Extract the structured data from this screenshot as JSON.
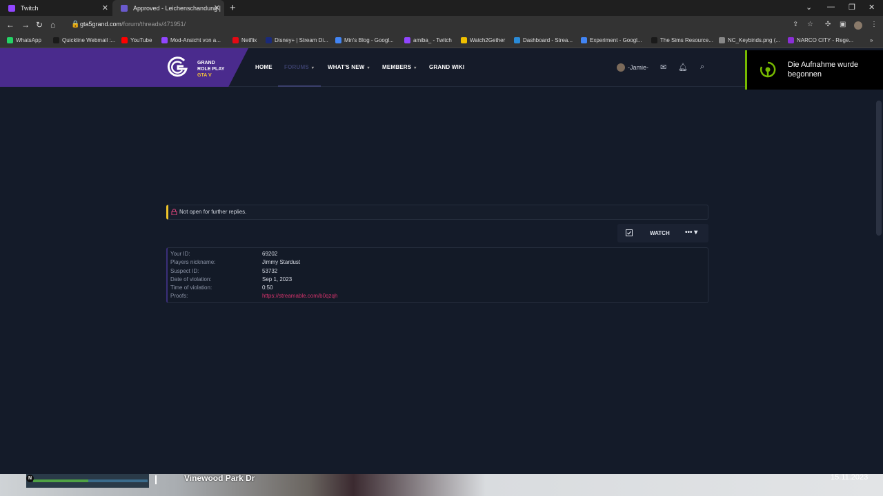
{
  "browser": {
    "tabs": [
      {
        "label": "Twitch"
      },
      {
        "label": "Approved - Leichenschandung |"
      }
    ],
    "url_host": "gta5grand.com",
    "url_path": "/forum/threads/471951/",
    "bookmarks": [
      {
        "label": "WhatsApp",
        "color": "#25d366"
      },
      {
        "label": "Quickline Webmail :...",
        "color": "#1a1a1a"
      },
      {
        "label": "YouTube",
        "color": "#ff0000"
      },
      {
        "label": "Mod-Ansicht von a...",
        "color": "#9146ff"
      },
      {
        "label": "Netflix",
        "color": "#e50914"
      },
      {
        "label": "Disney+ | Stream Di...",
        "color": "#1a2a7a"
      },
      {
        "label": "Min's Blog - Googl...",
        "color": "#4285f4"
      },
      {
        "label": "amiba_ - Twitch",
        "color": "#9146ff"
      },
      {
        "label": "Watch2Gether",
        "color": "#f0c000"
      },
      {
        "label": "Dashboard - Strea...",
        "color": "#2a8bd8"
      },
      {
        "label": "Experiment - Googl...",
        "color": "#4285f4"
      },
      {
        "label": "The Sims Resource...",
        "color": "#1a1a1a"
      },
      {
        "label": "NC_Keybinds.png (...",
        "color": "#888888"
      },
      {
        "label": "NARCO CITY - Rege...",
        "color": "#8b2fd6"
      }
    ]
  },
  "site": {
    "logo_line1": "GRAND",
    "logo_line2": "ROLE PLAY",
    "logo_line3": "GTA V",
    "nav": {
      "home": "HOME",
      "forums": "FORUMS",
      "whats_new": "WHAT'S NEW",
      "members": "MEMBERS",
      "wiki": "GRAND WIKI"
    },
    "username": "-Jamie-"
  },
  "overlay": {
    "text": "Die Aufnahme wurde begonnen"
  },
  "thread": {
    "notice": "Not open for further replies.",
    "watch": "WATCH",
    "more": "••• ▾",
    "fields": [
      {
        "label": "Your ID:",
        "value": "69202"
      },
      {
        "label": "Players nickname:",
        "value": "Jimmy Stardust"
      },
      {
        "label": "Suspect ID:",
        "value": "53732"
      },
      {
        "label": "Date of violation:",
        "value": "Sep 1, 2023"
      },
      {
        "label": "Time of violation:",
        "value": "0:50"
      },
      {
        "label": "Proofs:",
        "value": "https://streamable.com/b0qzqh"
      }
    ]
  },
  "game": {
    "street": "Vinewood Park Dr",
    "date": "15.11.2023",
    "compass": "N"
  }
}
